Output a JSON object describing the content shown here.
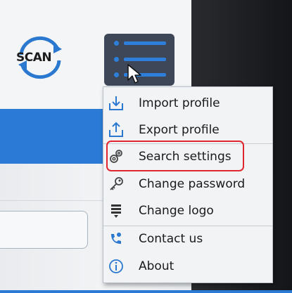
{
  "logo": {
    "text": "SCAN"
  },
  "colors": {
    "accent": "#2b7bd6",
    "menu_button": "#3e4757",
    "highlight": "#e0262e",
    "menu_bg": "#f2f3f5"
  },
  "menu_button": {
    "icon": "hamburger-list-icon"
  },
  "menu": {
    "items": [
      {
        "label": "Import profile",
        "icon": "import-icon"
      },
      {
        "label": "Export profile",
        "icon": "export-icon"
      },
      {
        "label": "Search settings",
        "icon": "gears-icon",
        "highlighted": true
      },
      {
        "label": "Change password",
        "icon": "key-icon"
      },
      {
        "label": "Change logo",
        "icon": "logo-stack-icon"
      },
      {
        "label": "Contact us",
        "icon": "phone-icon"
      },
      {
        "label": "About",
        "icon": "info-icon"
      }
    ]
  }
}
